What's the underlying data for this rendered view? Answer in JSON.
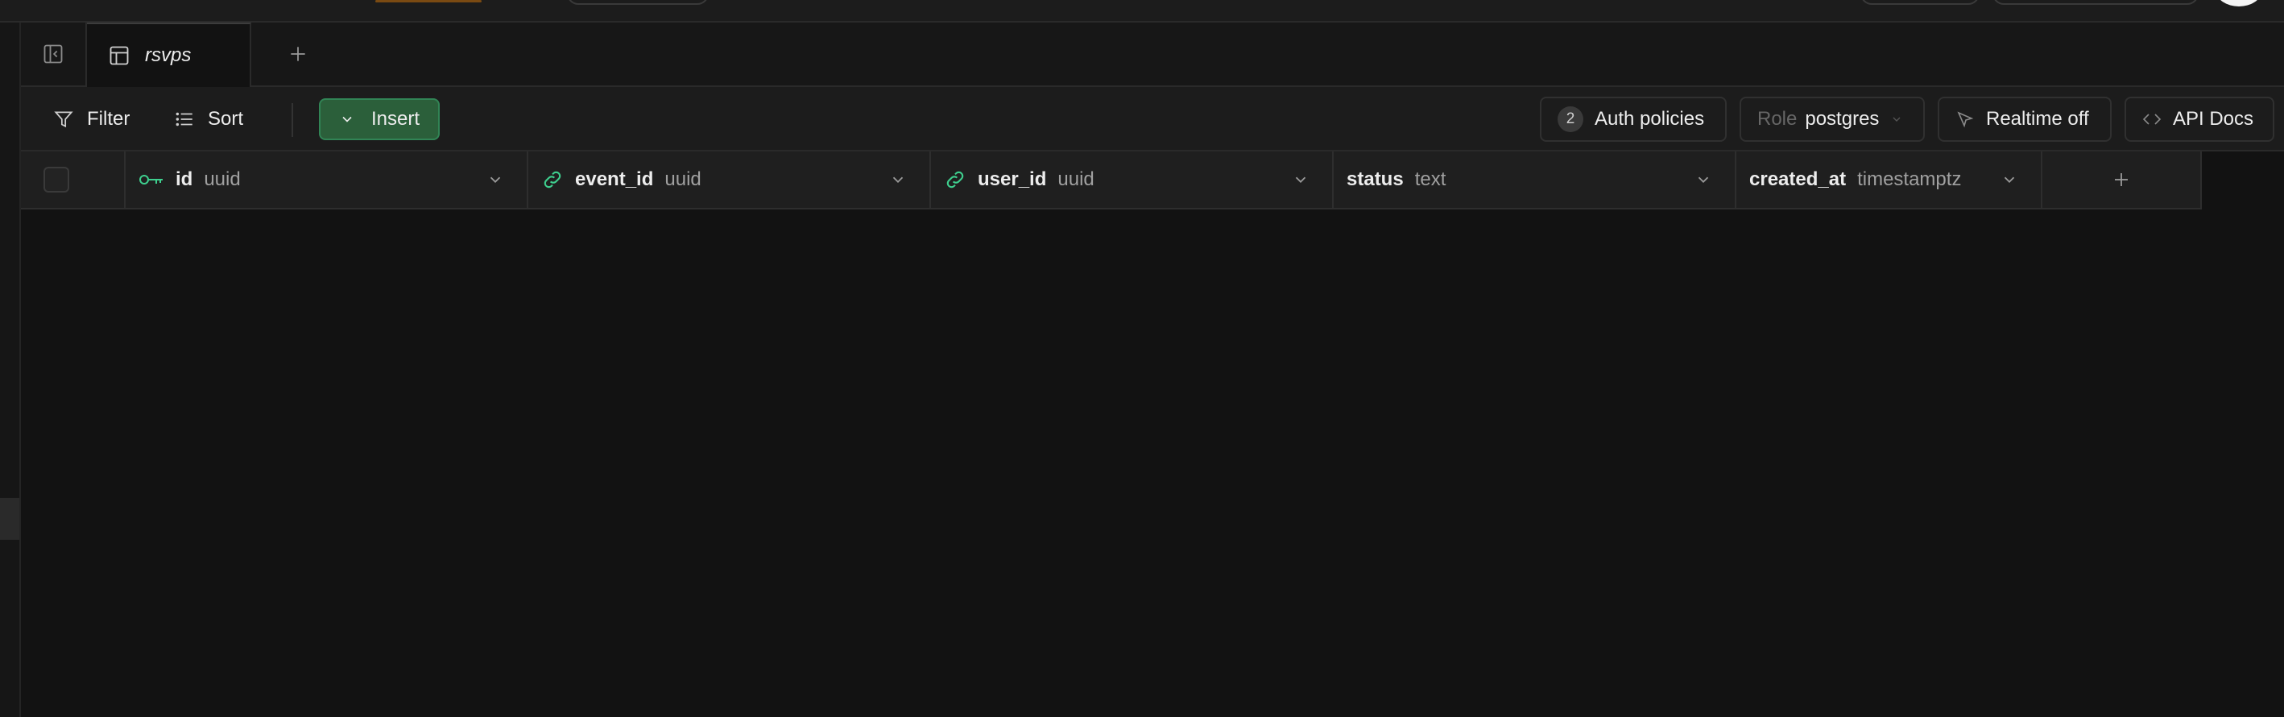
{
  "tab": {
    "label": "rsvps"
  },
  "toolbar": {
    "filter_label": "Filter",
    "sort_label": "Sort",
    "insert_label": "Insert",
    "auth_policies_count": "2",
    "auth_policies_label": "Auth policies",
    "role_prefix": "Role",
    "role_value": "postgres",
    "realtime_label": "Realtime off",
    "api_docs_label": "API Docs"
  },
  "columns": [
    {
      "name": "id",
      "type": "uuid",
      "icon": "key-icon"
    },
    {
      "name": "event_id",
      "type": "uuid",
      "icon": "link-icon"
    },
    {
      "name": "user_id",
      "type": "uuid",
      "icon": "link-icon"
    },
    {
      "name": "status",
      "type": "text",
      "icon": ""
    },
    {
      "name": "created_at",
      "type": "timestamptz",
      "icon": ""
    }
  ],
  "colors": {
    "background": "#121212",
    "accent": "#3ecf8e",
    "insert_bg": "#2b5f3a"
  }
}
